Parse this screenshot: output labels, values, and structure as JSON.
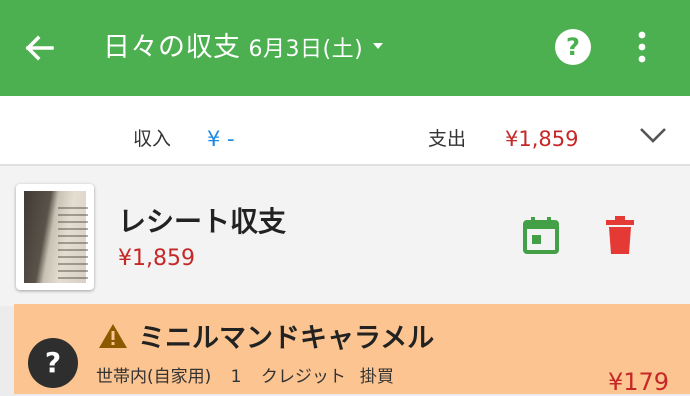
{
  "header": {
    "title": "日々の収支",
    "date": "6月3日(土)",
    "icons": {
      "back": "arrow-left-icon",
      "help": "help-circle-icon",
      "more": "more-vert-icon",
      "date_dropdown": "caret-down-icon"
    },
    "color": "#4caf50"
  },
  "summary": {
    "income_label": "収入",
    "income_value": "¥ -",
    "expense_label": "支出",
    "expense_value": "¥1,859",
    "expand_icon": "chevron-down-icon"
  },
  "receipt": {
    "title": "レシート収支",
    "amount": "¥1,859",
    "icons": {
      "calendar": "calendar-icon",
      "delete": "trash-icon",
      "thumbnail": "receipt-thumbnail"
    }
  },
  "items": [
    {
      "name": "ミニルマンドキャラメル",
      "category": "世帯内(自家用)",
      "quantity": "1",
      "payment": "クレジット",
      "type": "掛買",
      "price": "¥179",
      "icons": {
        "warning": "warning-icon",
        "help": "help-badge-icon"
      }
    }
  ],
  "colors": {
    "income": "#1e88e5",
    "expense": "#c62828",
    "item_bg": "#fbc490",
    "calendar": "#43a047",
    "delete": "#e53935"
  }
}
